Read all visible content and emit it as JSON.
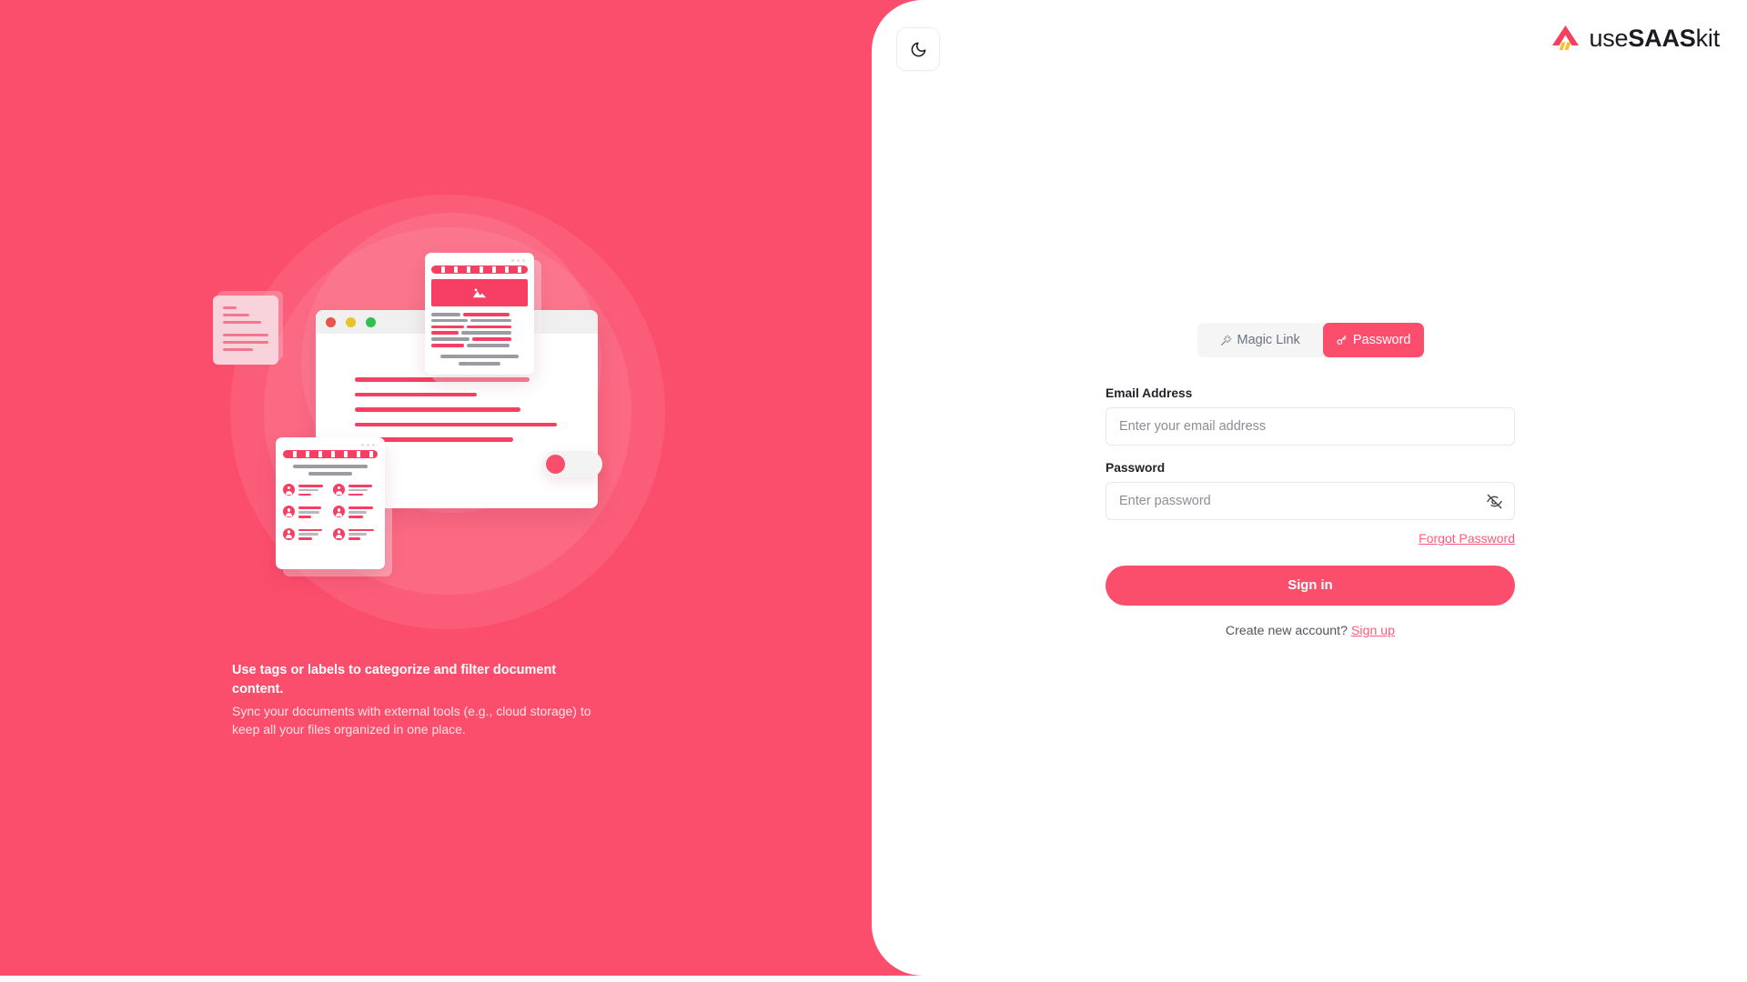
{
  "brand": {
    "name_light": "use",
    "name_bold": "SAAS",
    "name_tail": "kit",
    "logo_icon": "mountain-logo-icon",
    "primary_color": "#FB4E6D",
    "accent_yellow": "#FBBF24"
  },
  "theme_toggle": {
    "icon": "moon-icon",
    "label": "Toggle dark mode"
  },
  "hero": {
    "background_color": "#FB4E6D",
    "title": "Use tags or labels to categorize and filter document content.",
    "subtitle": "Sync your documents with external tools (e.g., cloud storage) to keep all your files organized in one place.",
    "illustration": {
      "name": "document-management-illustration",
      "browser_window": {
        "traffic_lights": [
          "#E8544B",
          "#E8C32B",
          "#2FC04F"
        ],
        "content_line_widths": [
          "84%",
          "58%",
          "80%",
          "94%",
          "78%"
        ]
      },
      "image_card": {
        "icon": "image-placeholder-icon",
        "banner_color": "#F73F63"
      },
      "contacts_card": {
        "contact_count": 6
      },
      "note_card": {
        "background_color": "#F9D3DB"
      },
      "toggle_switch": {
        "state": "off",
        "knob_color": "#FB4E6D"
      }
    }
  },
  "auth": {
    "tabs": [
      {
        "id": "magic-link",
        "label": "Magic Link",
        "icon": "wand-icon",
        "active": false
      },
      {
        "id": "password",
        "label": "Password",
        "icon": "key-icon",
        "active": true
      }
    ],
    "email": {
      "label": "Email Address",
      "placeholder": "Enter your email address",
      "value": ""
    },
    "password": {
      "label": "Password",
      "placeholder": "Enter password",
      "value": "",
      "visibility_icon": "eye-off-icon"
    },
    "forgot_password_label": "Forgot Password",
    "submit_label": "Sign in",
    "footer_prompt": "Create new account?",
    "footer_link_label": "Sign up"
  }
}
